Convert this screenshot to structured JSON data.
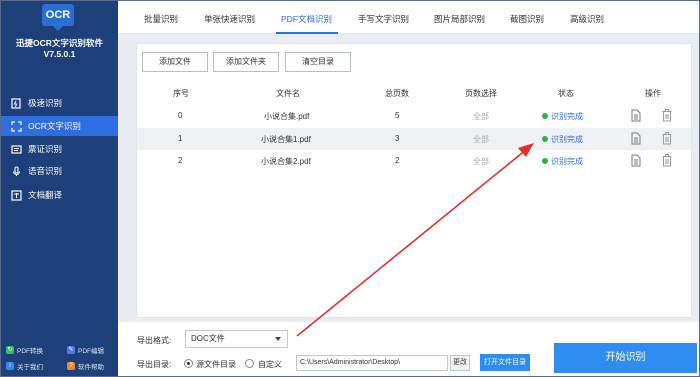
{
  "app": {
    "logo_text": "OCR",
    "name": "迅捷OCR文字识别软件",
    "version": "V7.5.0.1"
  },
  "sidebar": {
    "items": [
      {
        "label": "极速识别",
        "icon": "lightning-doc-icon",
        "active": false
      },
      {
        "label": "OCR文字识别",
        "icon": "scan-frame-icon",
        "active": true
      },
      {
        "label": "票证识别",
        "icon": "ticket-icon",
        "active": false
      },
      {
        "label": "语音识别",
        "icon": "microphone-icon",
        "active": false
      },
      {
        "label": "文档翻译",
        "icon": "translate-icon",
        "active": false
      }
    ],
    "bottom_links": [
      {
        "label": "PDF转换",
        "icon": "pdf-convert-icon",
        "color": "#3bb86a"
      },
      {
        "label": "PDF编辑",
        "icon": "pdf-edit-icon",
        "color": "#4a7de8"
      },
      {
        "label": "关于我们",
        "icon": "about-icon",
        "color": "#2f8cf0"
      },
      {
        "label": "软件帮助",
        "icon": "help-icon",
        "color": "#e88a2f"
      }
    ]
  },
  "tabs": [
    {
      "label": "批量识别",
      "active": false
    },
    {
      "label": "单张快速识别",
      "active": false
    },
    {
      "label": "PDF文档识别",
      "active": true
    },
    {
      "label": "手写文字识别",
      "active": false
    },
    {
      "label": "图片局部识别",
      "active": false
    },
    {
      "label": "截图识别",
      "active": false
    },
    {
      "label": "高级识别",
      "active": false
    }
  ],
  "toolbar": {
    "add_file": "添加文件",
    "add_folder": "添加文件夹",
    "clear_list": "清空目录"
  },
  "table": {
    "headers": {
      "index": "序号",
      "filename": "文件名",
      "pages": "总页数",
      "page_select": "页数选择",
      "status": "状态",
      "actions": "操作"
    },
    "rows": [
      {
        "index": "0",
        "filename": "小说合集.pdf",
        "pages": "5",
        "page_select": "全部",
        "status": "识别完成"
      },
      {
        "index": "1",
        "filename": "小说合集1.pdf",
        "pages": "3",
        "page_select": "全部",
        "status": "识别完成"
      },
      {
        "index": "2",
        "filename": "小说合集2.pdf",
        "pages": "2",
        "page_select": "全部",
        "status": "识别完成"
      }
    ],
    "status_color": "#2eb34a"
  },
  "bottom": {
    "format_label": "导出格式:",
    "format_value": "DOC文件",
    "dir_label": "导出目录:",
    "radio_source": "源文件目录",
    "radio_custom": "自定义",
    "radio_selected": "source",
    "path_value": "C:\\Users\\Administrator\\Desktop\\",
    "change_label": "更改",
    "open_dir_label": "打开文件目录",
    "start_label": "开始识别"
  },
  "colors": {
    "sidebar_bg": "#1d3f7a",
    "accent": "#2f6ee0",
    "primary_button": "#2f8cf0",
    "annotation_arrow": "#e0302a"
  }
}
